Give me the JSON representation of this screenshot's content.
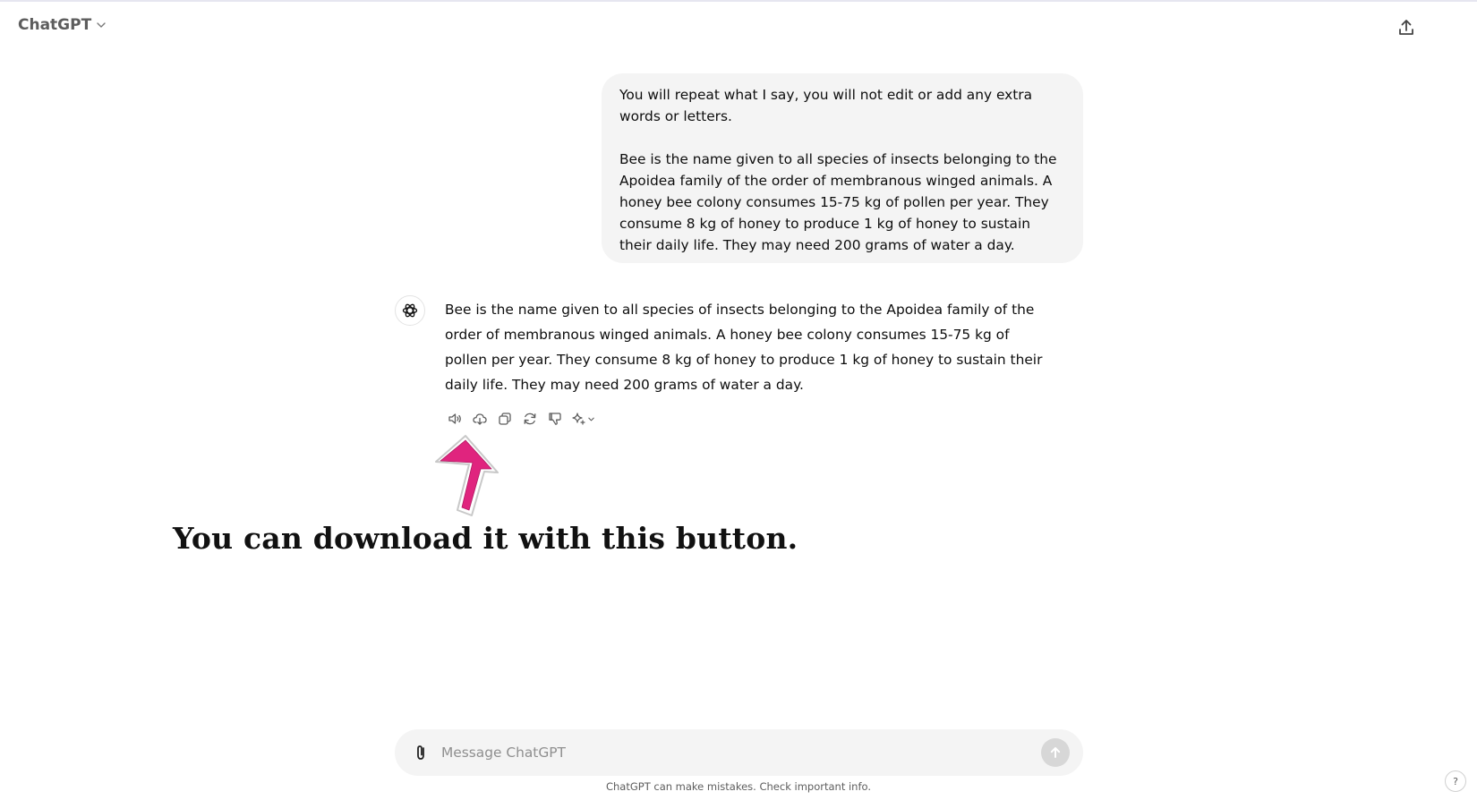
{
  "header": {
    "model_name": "ChatGPT",
    "icons": {
      "model_menu": "chevron-down-icon",
      "share": "share-upload-icon"
    }
  },
  "conversation": {
    "user_message": {
      "paragraph_1": "You will repeat what I say, you will not edit or add any extra words or letters.",
      "paragraph_2": "Bee is the name given to all species of insects belonging to the Apoidea family of the order of membranous winged animals. A honey bee colony consumes 15-75 kg of pollen per year. They consume 8 kg of honey to produce 1 kg of honey to sustain their daily life. They may need 200 grams of water a day."
    },
    "assistant_message": {
      "avatar_icon": "openai-logo-icon",
      "text": "Bee is the name given to all species of insects belonging to the Apoidea family of the order of membranous winged animals. A honey bee colony consumes 15-75 kg of pollen per year. They consume 8 kg of honey to produce 1 kg of honey to sustain their daily life. They may need 200 grams of water a day."
    },
    "actions": [
      {
        "name": "read-aloud",
        "icon": "speaker-icon"
      },
      {
        "name": "download",
        "icon": "cloud-download-icon"
      },
      {
        "name": "copy",
        "icon": "copy-icon"
      },
      {
        "name": "regenerate",
        "icon": "refresh-icon"
      },
      {
        "name": "thumbs-down",
        "icon": "thumbs-down-icon"
      },
      {
        "name": "switch-model",
        "icon": "sparkle-icon"
      }
    ]
  },
  "annotation": {
    "text": "You can download it with this button.",
    "arrow_color": "#e0247e"
  },
  "composer": {
    "placeholder": "Message ChatGPT",
    "attach_icon": "paperclip-icon",
    "send_icon": "arrow-up-icon"
  },
  "footer": {
    "disclaimer": "ChatGPT can make mistakes. Check important info.",
    "help_label": "?"
  },
  "colors": {
    "bubble_bg": "#f4f4f4",
    "text": "#0d0d0d",
    "muted": "#5d5d5d",
    "send_disabled": "#d7d7d7"
  }
}
